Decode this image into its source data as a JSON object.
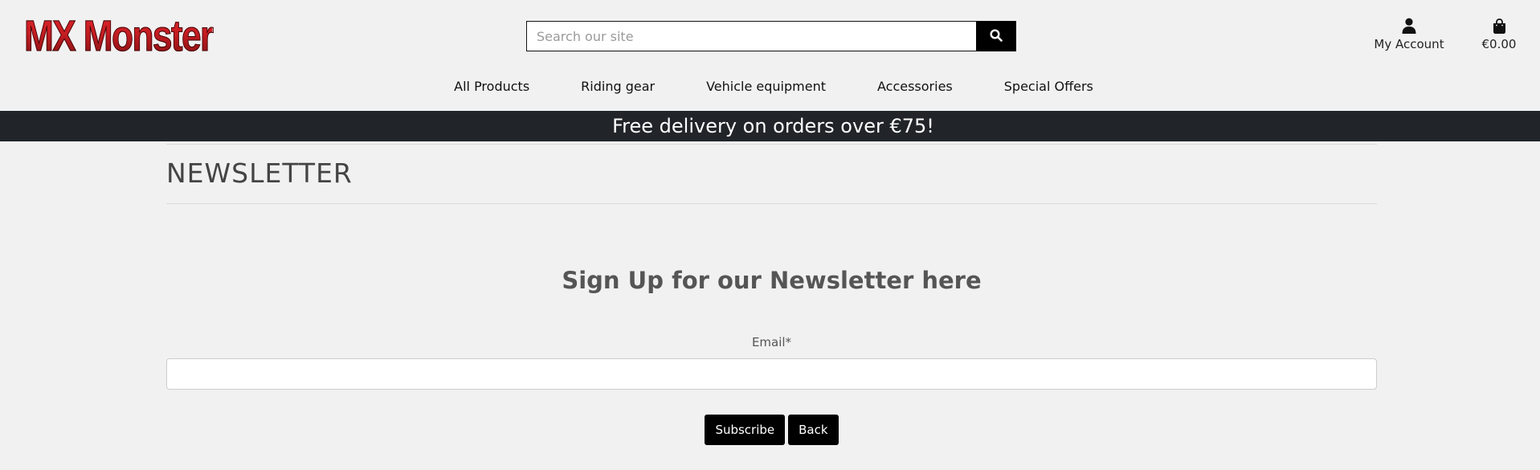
{
  "header": {
    "logo_text": "MX Monster",
    "search": {
      "placeholder": "Search our site",
      "value": ""
    },
    "account_label": "My Account",
    "cart_total": "€0.00"
  },
  "nav": {
    "items": [
      {
        "label": "All Products"
      },
      {
        "label": "Riding gear"
      },
      {
        "label": "Vehicle equipment"
      },
      {
        "label": "Accessories"
      },
      {
        "label": "Special Offers"
      }
    ]
  },
  "banner": {
    "text": "Free delivery on orders over €75!"
  },
  "page": {
    "title": "NEWSLETTER",
    "form_heading": "Sign Up for our Newsletter here",
    "email_label": "Email*",
    "email_value": "",
    "subscribe_label": "Subscribe",
    "back_label": "Back"
  },
  "icons": {
    "search": "search-icon",
    "account": "user-icon",
    "cart": "shopping-bag-icon"
  },
  "colors": {
    "brand_red": "#c41d22",
    "banner_bg": "#212529",
    "button_bg": "#000000",
    "page_bg": "#f1f1f1"
  }
}
